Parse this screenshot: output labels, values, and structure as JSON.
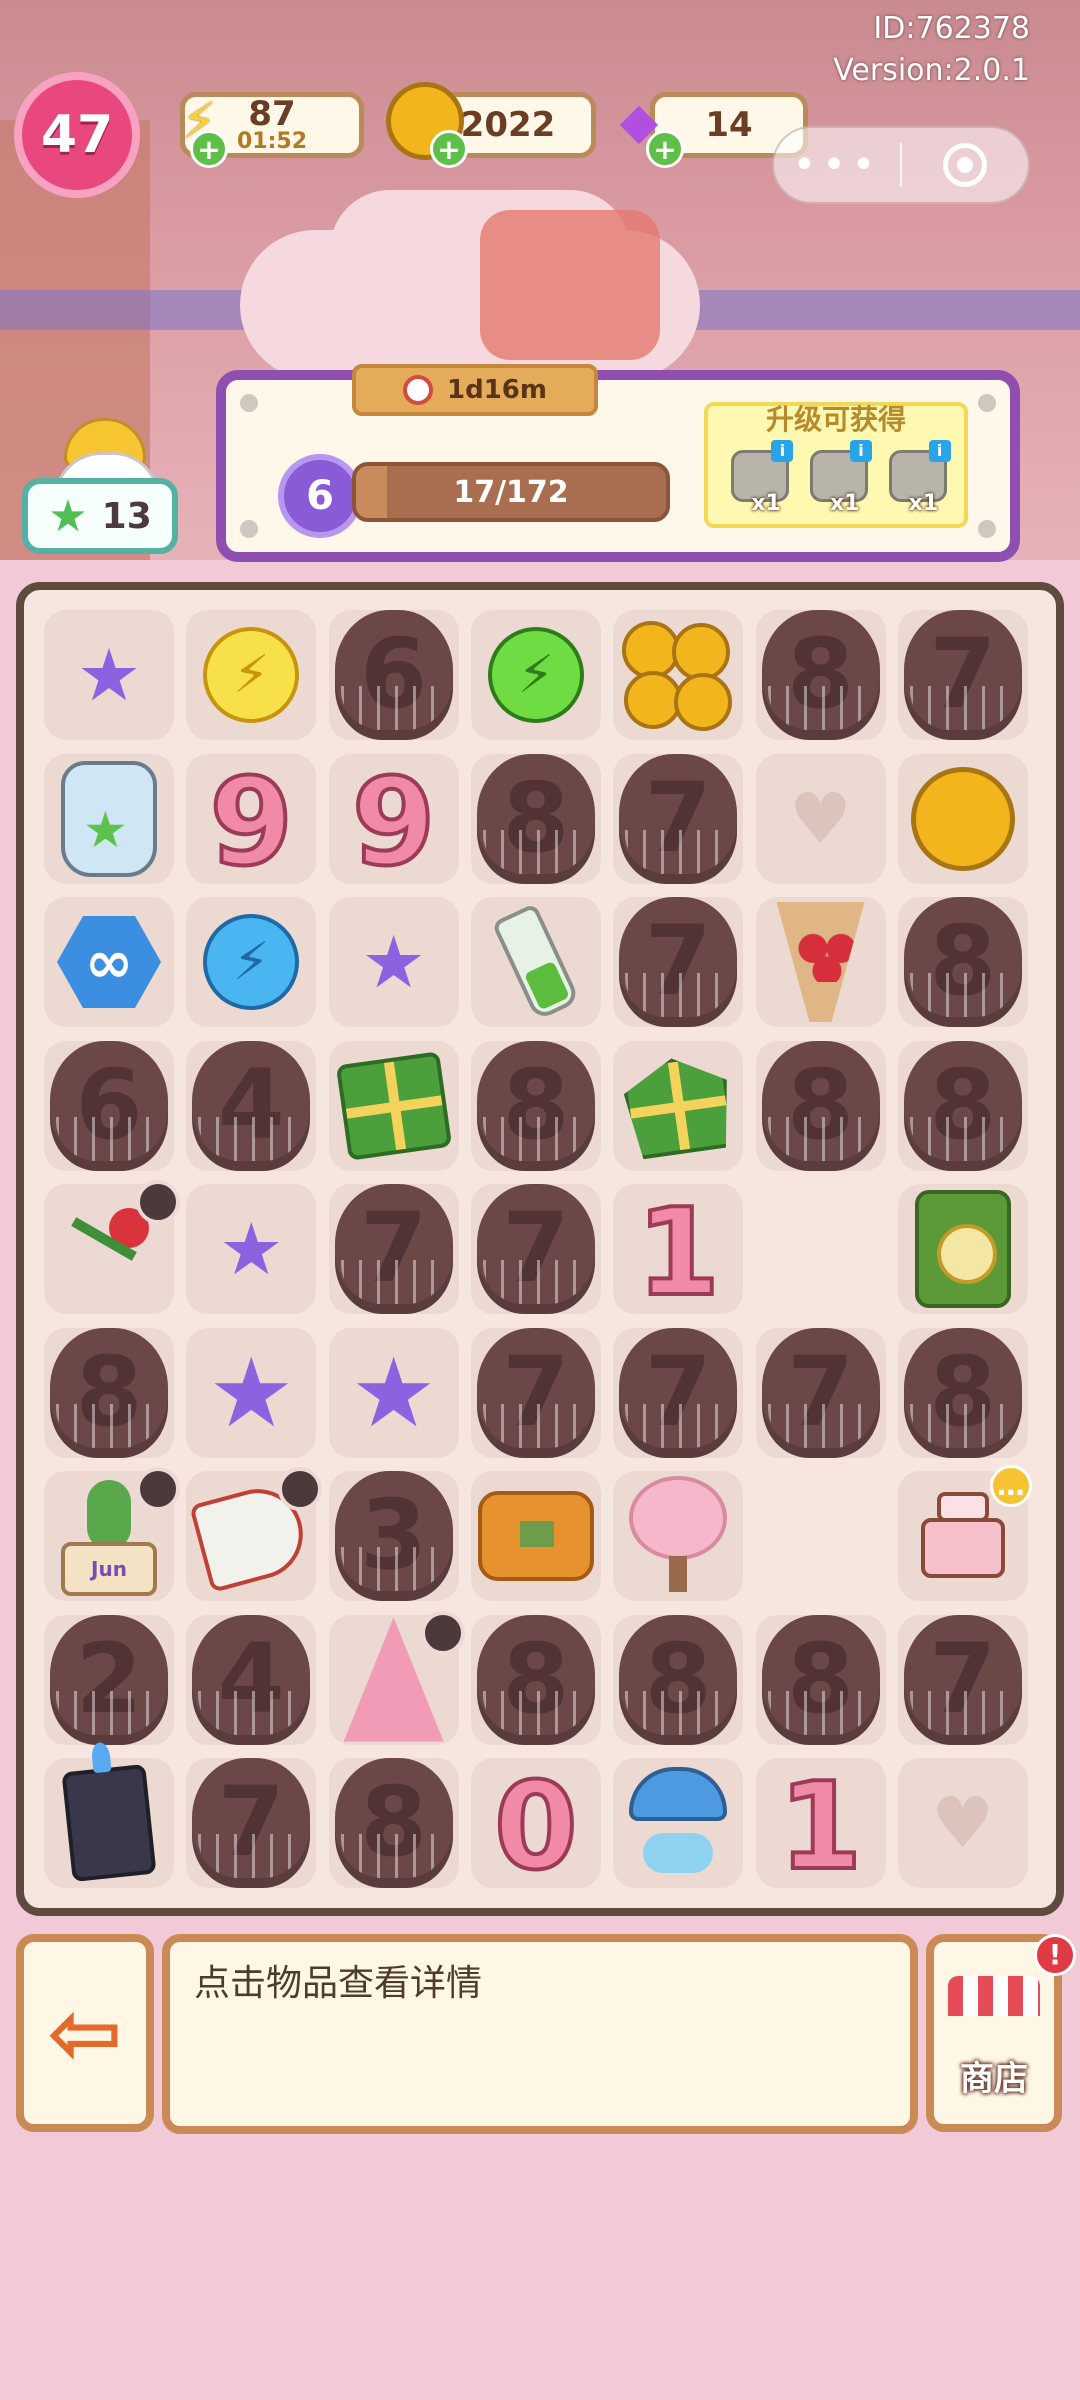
{
  "header": {
    "player_id": "ID:762378",
    "version": "Version:2.0.1",
    "level": "47",
    "energy": {
      "value": "87",
      "timer": "01:52"
    },
    "coins": {
      "value": "2022"
    },
    "gems": {
      "value": "14"
    }
  },
  "star_counter": "13",
  "level_panel": {
    "timer": "1d16m",
    "level": "6",
    "progress_text": "17/172",
    "progress_fraction": 0.099,
    "reward_title": "升级可获得",
    "rewards": [
      {
        "icon": "stone-icon",
        "count": "x1",
        "info": "i"
      },
      {
        "icon": "stone-icon",
        "count": "x1",
        "info": "i"
      },
      {
        "icon": "stone-icon",
        "count": "x1",
        "info": "i"
      }
    ]
  },
  "board": {
    "rows": [
      [
        "star-small",
        "bolt-yellow",
        "blob:6",
        "bolt-green",
        "coins",
        "blob:8",
        "blob:7"
      ],
      [
        "jar",
        "candle:9",
        "candle:9",
        "blob:8",
        "blob:7",
        "empty-heart",
        "coin"
      ],
      [
        "infinity-hex",
        "bolt-blue",
        "star-tiny",
        "vial",
        "blob:7",
        "bouquet",
        "blob:8"
      ],
      [
        "blob:6",
        "blob:4",
        "gift",
        "blob:8",
        "gift-open",
        "blob:8",
        "blob:8"
      ],
      [
        "rose",
        "star-small",
        "blob:7",
        "blob:7",
        "candle:1",
        "empty",
        "lantern"
      ],
      [
        "blob:8",
        "star-big",
        "star",
        "blob:7",
        "blob:7",
        "blob:7",
        "blob:8"
      ],
      [
        "cactus",
        "megaphone",
        "blob:3",
        "sofa",
        "tree",
        "empty",
        "cake"
      ],
      [
        "blob:2",
        "blob:4",
        "xtree",
        "blob:8",
        "blob:8",
        "blob:8",
        "blob:7"
      ],
      [
        "bucket",
        "blob:7",
        "blob:8",
        "candle:0",
        "umbrella",
        "candle:1",
        "empty-heart"
      ]
    ],
    "cactus_label": "Jun"
  },
  "footer": {
    "info_text": "点击物品查看详情",
    "shop_label": "商店"
  }
}
